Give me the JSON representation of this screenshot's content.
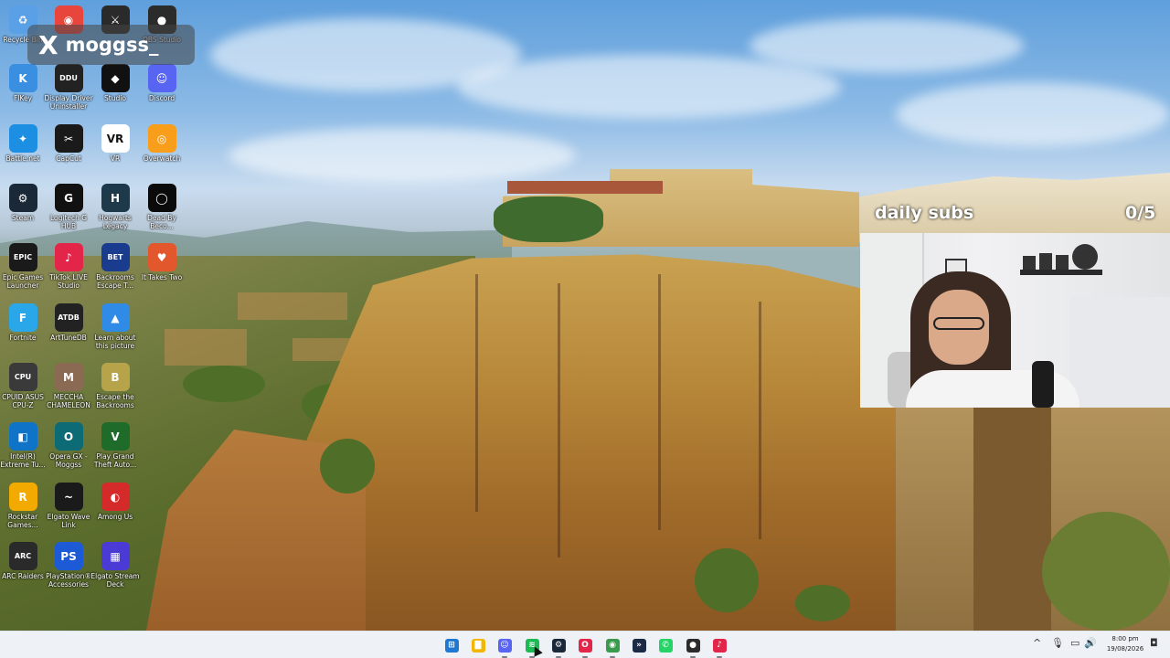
{
  "overlay": {
    "x_logo": "X",
    "x_handle": "moggss_",
    "subs_label": "daily subs",
    "subs_count": "0/5"
  },
  "desktop_icons": [
    {
      "name": "recycle-bin",
      "label": "Recycle Bin",
      "glyph": "♻",
      "color": "#5aa0e6"
    },
    {
      "name": "chrome",
      "label": "",
      "glyph": "◉",
      "color": "#e8453c"
    },
    {
      "name": "dark-app",
      "label": "",
      "glyph": "⚔",
      "color": "#2a2a2a"
    },
    {
      "name": "obs-studio",
      "label": "OBS Studio",
      "glyph": "●",
      "color": "#2b2b2b"
    },
    {
      "name": "fl-key",
      "label": "FlKey",
      "glyph": "K",
      "color": "#3b8fe0"
    },
    {
      "name": "ddu",
      "label": "Display Driver Uninstaller",
      "glyph": "DDU",
      "color": "#222222"
    },
    {
      "name": "roblox-studio",
      "label": "Studio",
      "glyph": "◆",
      "color": "#111111"
    },
    {
      "name": "discord",
      "label": "Discord",
      "glyph": "☺",
      "color": "#5865f2"
    },
    {
      "name": "battle-net",
      "label": "Battle.net",
      "glyph": "✦",
      "color": "#1c8fe3"
    },
    {
      "name": "capcut",
      "label": "CapCut",
      "glyph": "✂",
      "color": "#1a1a1a"
    },
    {
      "name": "vr",
      "label": "VR",
      "glyph": "VR",
      "color": "#ffffff"
    },
    {
      "name": "overwatch",
      "label": "Overwatch",
      "glyph": "◎",
      "color": "#f99e1a"
    },
    {
      "name": "steam",
      "label": "Steam",
      "glyph": "⚙",
      "color": "#1b2838"
    },
    {
      "name": "logitech-g-hub",
      "label": "Logitech G HUB",
      "glyph": "G",
      "color": "#111111"
    },
    {
      "name": "hogwarts-legacy",
      "label": "Hogwarts Legacy",
      "glyph": "H",
      "color": "#1e3a4a"
    },
    {
      "name": "black-app",
      "label": "Dead By Beco...",
      "glyph": "◯",
      "color": "#0a0a0a"
    },
    {
      "name": "epic-games",
      "label": "Epic Games Launcher",
      "glyph": "EPIC",
      "color": "#1a1a1a"
    },
    {
      "name": "tiktok-live",
      "label": "TikTok LIVE Studio",
      "glyph": "♪",
      "color": "#e3254a"
    },
    {
      "name": "backrooms-escape",
      "label": "Backrooms Escape T...",
      "glyph": "BET",
      "color": "#1a3c8f"
    },
    {
      "name": "it-takes-two",
      "label": "It Takes Two",
      "glyph": "♥",
      "color": "#e2572b"
    },
    {
      "name": "fortnite",
      "label": "Fortnite",
      "glyph": "F",
      "color": "#2aa7e8"
    },
    {
      "name": "arttunedb",
      "label": "ArtTuneDB",
      "glyph": "ATDB",
      "color": "#222222"
    },
    {
      "name": "learn-about-picture",
      "label": "Learn about this picture",
      "glyph": "▲",
      "color": "#2f8be6"
    },
    {
      "name": "cpuid",
      "label": "CPUID ASUS CPU-Z",
      "glyph": "CPU",
      "color": "#3a3a3a"
    },
    {
      "name": "meccha-chameleon",
      "label": "MECCHA CHAMELEON",
      "glyph": "M",
      "color": "#8a6a52"
    },
    {
      "name": "escape-backrooms",
      "label": "Escape the Backrooms",
      "glyph": "B",
      "color": "#b7a34a"
    },
    {
      "name": "intel-xtu",
      "label": "Intel(R) Extreme Tu...",
      "glyph": "◧",
      "color": "#0f74c8"
    },
    {
      "name": "opera-gx",
      "label": "Opera GX - Moggss",
      "glyph": "O",
      "color": "#0d6b75"
    },
    {
      "name": "gta",
      "label": "Play Grand Theft Auto...",
      "glyph": "V",
      "color": "#1f6b2a"
    },
    {
      "name": "rockstar-games",
      "label": "Rockstar Games...",
      "glyph": "R",
      "color": "#f2a900"
    },
    {
      "name": "elgato-wave-link",
      "label": "Elgato Wave Link",
      "glyph": "~",
      "color": "#1a1a1a"
    },
    {
      "name": "among-us",
      "label": "Among Us",
      "glyph": "◐",
      "color": "#d42a2a"
    },
    {
      "name": "arc-raiders",
      "label": "ARC Raiders",
      "glyph": "ARC",
      "color": "#2a2a2a"
    },
    {
      "name": "playstation-accessories",
      "label": "PlayStation® Accessories",
      "glyph": "PS",
      "color": "#1d5bd6"
    },
    {
      "name": "elgato-stream-deck",
      "label": "Elgato Stream Deck",
      "glyph": "▦",
      "color": "#4b3bd6"
    }
  ],
  "taskbar": {
    "apps": [
      {
        "name": "start-button",
        "glyph": "⊞",
        "color": "#1f78d1"
      },
      {
        "name": "file-explorer",
        "glyph": "▇",
        "color": "#f2b705"
      },
      {
        "name": "discord",
        "glyph": "☺",
        "color": "#5865f2"
      },
      {
        "name": "spotify",
        "glyph": "≋",
        "color": "#1db954"
      },
      {
        "name": "steam",
        "glyph": "⚙",
        "color": "#1b2838"
      },
      {
        "name": "opera-gx",
        "glyph": "O",
        "color": "#e3254a"
      },
      {
        "name": "chrome",
        "glyph": "◉",
        "color": "#3a9b4c"
      },
      {
        "name": "battle-net",
        "glyph": "»",
        "color": "#1b2a44"
      },
      {
        "name": "whatsapp",
        "glyph": "✆",
        "color": "#25d366"
      },
      {
        "name": "obs-studio",
        "glyph": "●",
        "color": "#2b2b2b"
      },
      {
        "name": "tiktok-live",
        "glyph": "♪",
        "color": "#e3254a"
      }
    ],
    "tray": {
      "chevron": "^",
      "mic": "🎙",
      "network": "▭",
      "volume": "🔊"
    },
    "time": "8:00 pm",
    "date": "19/08/2026",
    "notification": "◘"
  }
}
